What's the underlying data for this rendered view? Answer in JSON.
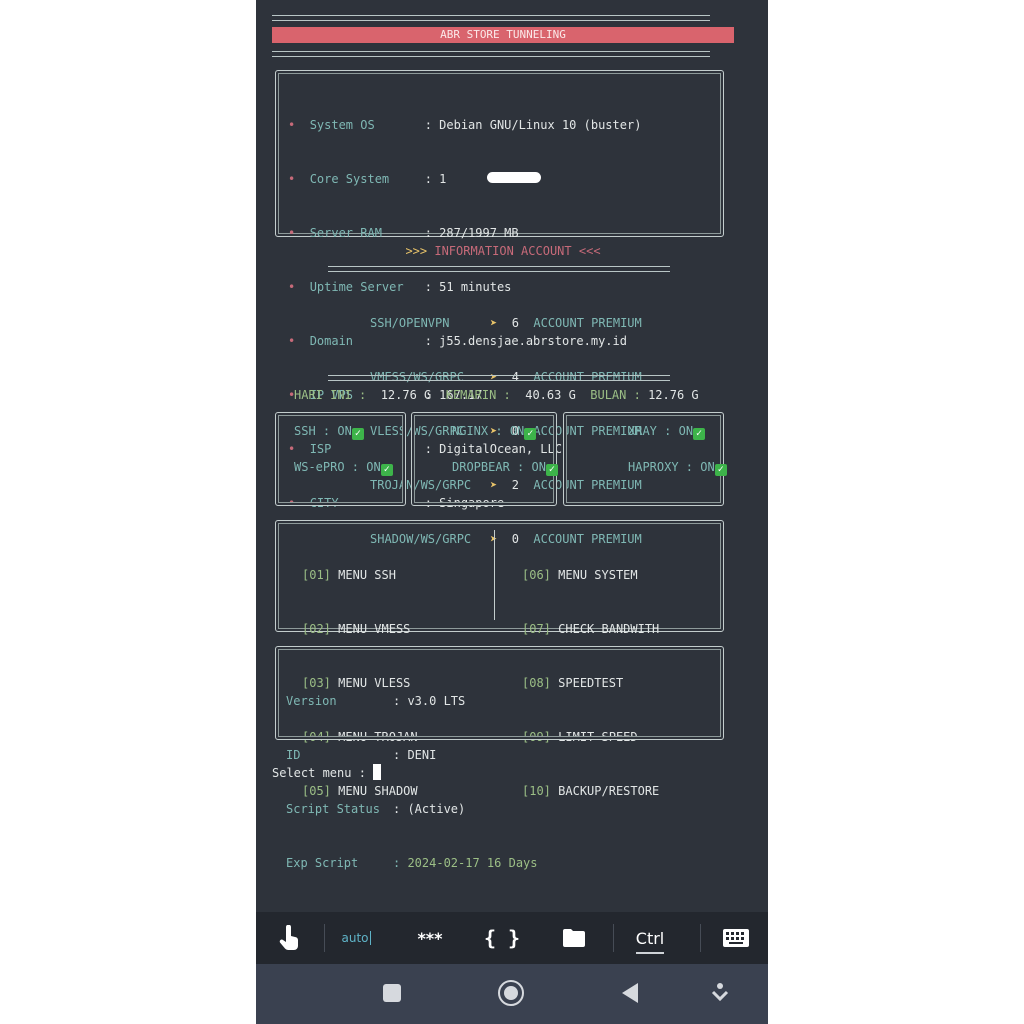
{
  "header": {
    "title": "ABR STORE TUNNELING"
  },
  "system": {
    "rows": [
      {
        "label": "System OS",
        "value": "Debian GNU/Linux 10 (buster)"
      },
      {
        "label": "Core System",
        "value": "1"
      },
      {
        "label": "Server RAM",
        "value": "287/1997 MB"
      },
      {
        "label": "Uptime Server",
        "value": "51 minutes"
      },
      {
        "label": "Domain",
        "value": "j55.densjae.abrstore.my.id"
      },
      {
        "label": "IP VPS",
        "value": "167.17"
      },
      {
        "label": "ISP",
        "value": "DigitalOcean, LLC"
      },
      {
        "label": "CITY",
        "value": "Singapore"
      }
    ]
  },
  "account_info": {
    "heading_left": ">>>",
    "heading": "INFORMATION ACCOUNT",
    "heading_right": "<<<",
    "unit": "ACCOUNT PREMIUM",
    "rows": [
      {
        "label": "SSH/OPENVPN",
        "count": "6"
      },
      {
        "label": "VMESS/WS/GRPC",
        "count": "4"
      },
      {
        "label": "VLESS/WS/GRPC",
        "count": "0"
      },
      {
        "label": "TROJAN/WS/GRPC",
        "count": "2"
      },
      {
        "label": "SHADOW/WS/GRPC",
        "count": "0"
      }
    ]
  },
  "bandwidth": {
    "today_label": "HARI INI :",
    "today_value": "12.76 G",
    "yesterday_label": "KEMARIN :",
    "yesterday_value": "40.63 G",
    "month_label": "BULAN :",
    "month_value": "12.76 G"
  },
  "services": {
    "status": "ON",
    "items": [
      {
        "name": "SSH"
      },
      {
        "name": "NGINX"
      },
      {
        "name": "XRAY"
      },
      {
        "name": "WS-ePRO"
      },
      {
        "name": "DROPBEAR"
      },
      {
        "name": "HAPROXY"
      }
    ]
  },
  "menu": {
    "items": [
      {
        "num": "[01]",
        "label": "MENU SSH"
      },
      {
        "num": "[02]",
        "label": "MENU VMESS"
      },
      {
        "num": "[03]",
        "label": "MENU VLESS"
      },
      {
        "num": "[04]",
        "label": "MENU TROJAN"
      },
      {
        "num": "[05]",
        "label": "MENU SHADOW"
      },
      {
        "num": "[06]",
        "label": "MENU SYSTEM"
      },
      {
        "num": "[07]",
        "label": "CHECK BANDWITH"
      },
      {
        "num": "[08]",
        "label": "SPEEDTEST"
      },
      {
        "num": "[09]",
        "label": "LIMIT SPEED"
      },
      {
        "num": "[10]",
        "label": "BACKUP/RESTORE"
      }
    ]
  },
  "script_info": {
    "rows": [
      {
        "label": "Version",
        "value": "v3.0 LTS"
      },
      {
        "label": "ID",
        "value": "DENI"
      },
      {
        "label": "Script Status",
        "value": "(Active)"
      },
      {
        "label": "Exp Script",
        "value": "2024-02-17 16 Days"
      }
    ]
  },
  "prompt": {
    "text": "Select menu :"
  },
  "toolbar": {
    "auto_label": "auto",
    "stars_label": "***",
    "braces_label": "{ }",
    "ctrl_label": "Ctrl"
  },
  "icons": {
    "touch": "touch-icon",
    "folder": "folder-icon",
    "keyboard": "keyboard-icon",
    "recents": "square-icon",
    "home": "circle-icon",
    "back": "triangle-icon",
    "hide": "arrow-down-icon"
  },
  "colors": {
    "background": "#2e333b",
    "title_bar": "#d9646d",
    "accent_pink": "#c66a79",
    "teal": "#7fb8b4",
    "green": "#9cbf86",
    "arrow": "#e9c46a",
    "check": "#3db44a"
  }
}
